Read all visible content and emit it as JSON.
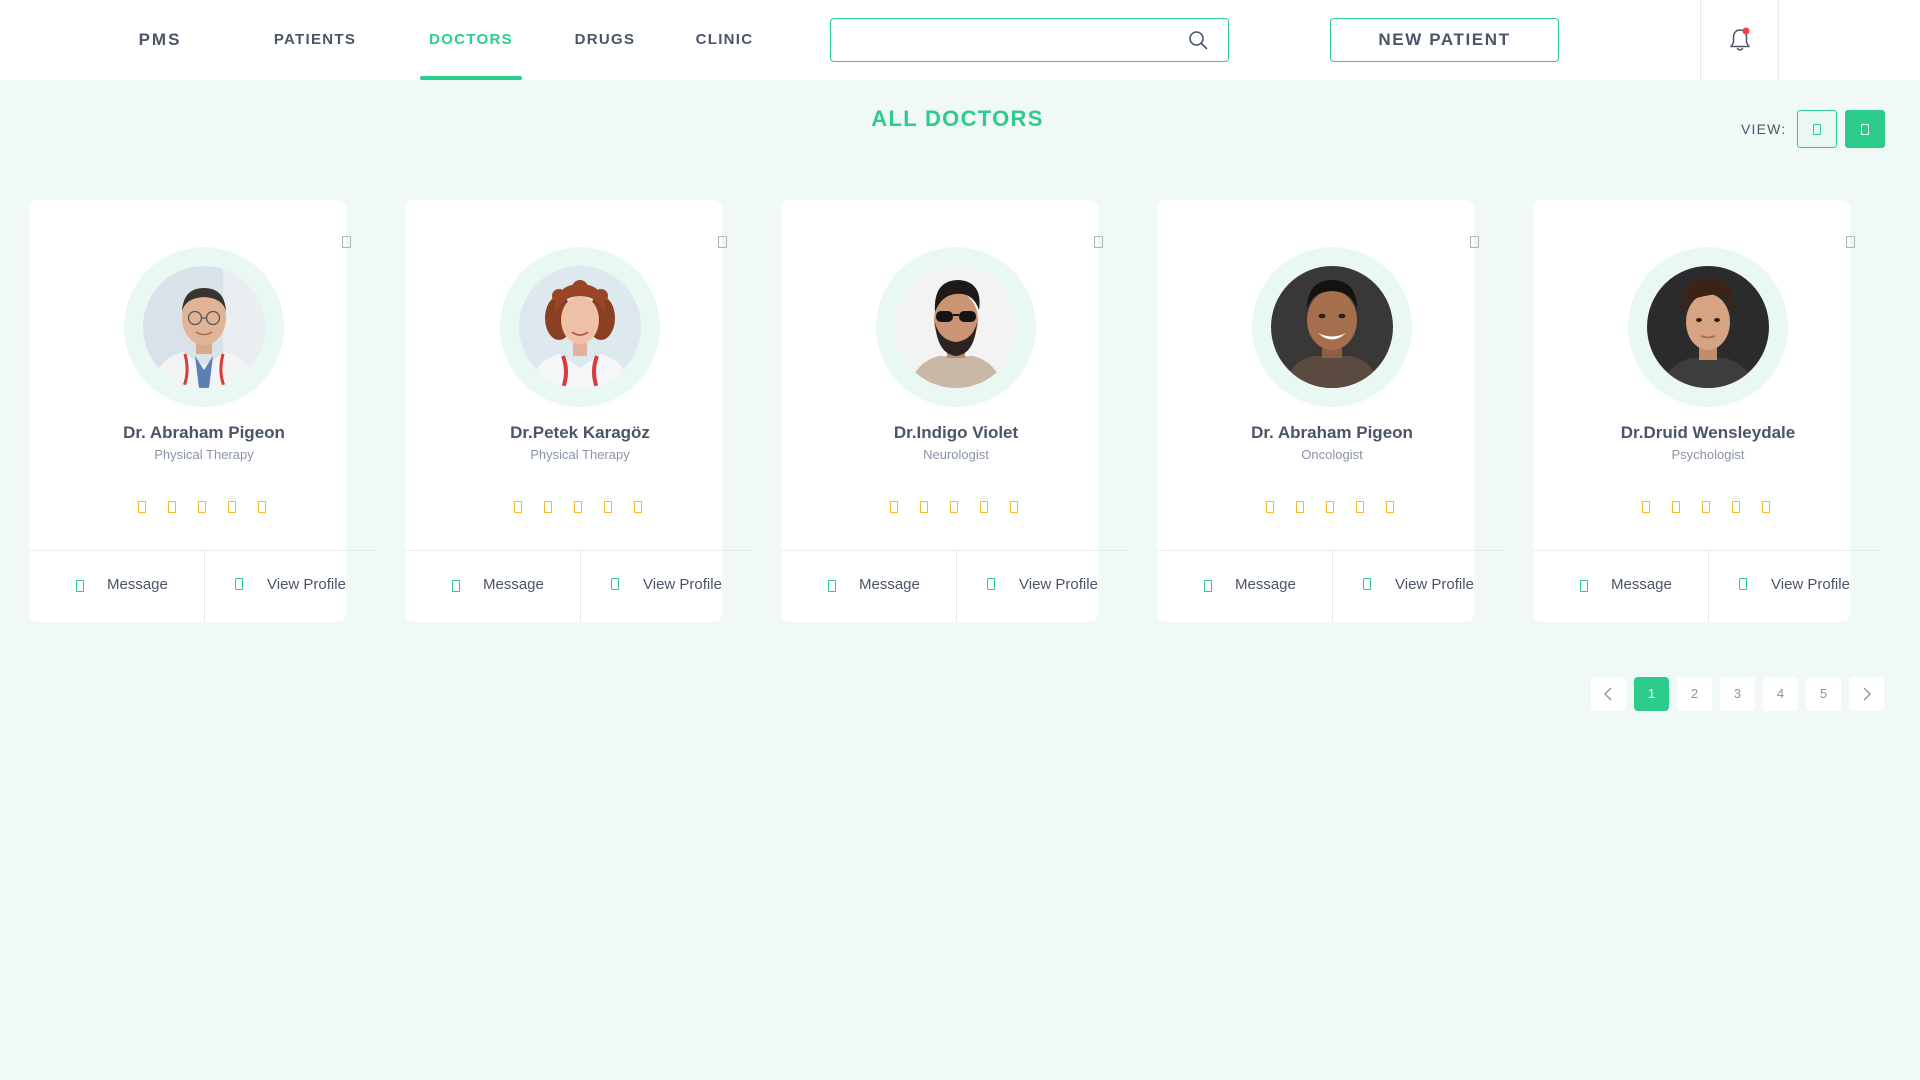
{
  "nav": {
    "brand": "PMS",
    "links": [
      {
        "label": "PATIENTS",
        "active": false
      },
      {
        "label": "DOCTORS",
        "active": true
      },
      {
        "label": "DRUGS",
        "active": false
      },
      {
        "label": "CLINIC",
        "active": false
      }
    ],
    "search": {
      "value": "",
      "placeholder": "",
      "icon": "search-icon"
    },
    "new_patient_label": "NEW PATIENT",
    "notification": {
      "icon": "bell-icon",
      "has_unread": true
    }
  },
  "page": {
    "title": "ALL DOCTORS",
    "view_label": "VIEW:",
    "view_modes": [
      {
        "name": "grid",
        "selected": false
      },
      {
        "name": "list",
        "selected": true
      }
    ]
  },
  "doctors": [
    {
      "name": "Dr. Abraham Pigeon",
      "specialty": "Physical Therapy",
      "rating": 5,
      "message_label": "Message",
      "profile_label": "View Profile"
    },
    {
      "name": "Dr.Petek Karagöz",
      "specialty": "Physical Therapy",
      "rating": 5,
      "message_label": "Message",
      "profile_label": "View Profile"
    },
    {
      "name": "Dr.Indigo Violet",
      "specialty": "Neurologist",
      "rating": 5,
      "message_label": "Message",
      "profile_label": "View Profile"
    },
    {
      "name": "Dr. Abraham Pigeon",
      "specialty": "Oncologist",
      "rating": 5,
      "message_label": "Message",
      "profile_label": "View Profile"
    },
    {
      "name": "Dr.Druid Wensleydale",
      "specialty": "Psychologist",
      "rating": 5,
      "message_label": "Message",
      "profile_label": "View Profile"
    }
  ],
  "pagination": {
    "pages": [
      "1",
      "2",
      "3",
      "4",
      "5"
    ],
    "current": "1"
  },
  "colors": {
    "accent": "#2bcc8c",
    "background": "#f1f9f7",
    "star": "#f5b62b",
    "notification_dot": "#ef4444",
    "text": "#4a5568",
    "muted": "#8a94a6"
  }
}
